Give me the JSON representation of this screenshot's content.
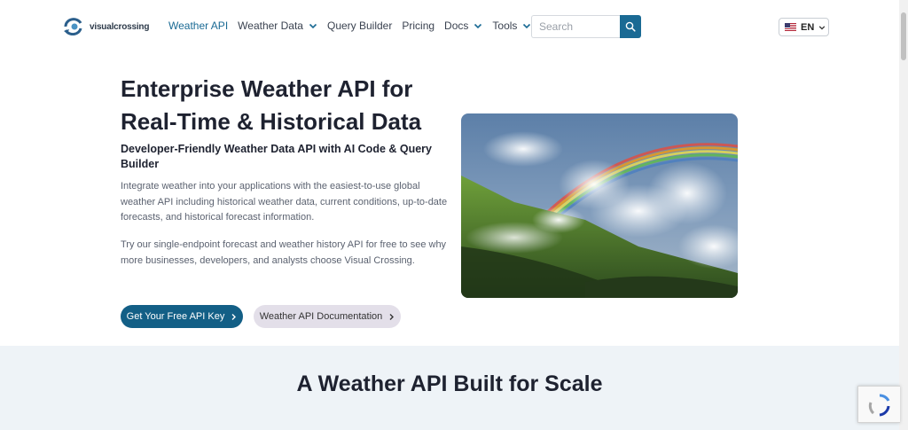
{
  "header": {
    "logo_text": "visualcrossing",
    "nav": [
      {
        "label": "Weather API",
        "dropdown": false,
        "active": true
      },
      {
        "label": "Weather Data",
        "dropdown": true,
        "active": false
      },
      {
        "label": "Query Builder",
        "dropdown": false,
        "active": false
      },
      {
        "label": "Pricing",
        "dropdown": false,
        "active": false
      },
      {
        "label": "Docs",
        "dropdown": true,
        "active": false
      },
      {
        "label": "Tools",
        "dropdown": true,
        "active": false
      }
    ],
    "search_placeholder": "Search",
    "language": "EN"
  },
  "hero": {
    "title": "Enterprise Weather API for Real-Time & Historical Data",
    "subtitle": "Developer-Friendly Weather Data API with AI Code & Query Builder",
    "paragraph_1": "Integrate weather into your applications with the easiest-to-use global weather API including historical weather data, current conditions, up-to-date forecasts, and historical forecast information.",
    "paragraph_2": "Try our single-endpoint forecast and weather history API for free to see why more businesses, developers, and analysts choose Visual Crossing.",
    "primary_button": "Get Your Free API Key",
    "secondary_button": "Weather API Documentation"
  },
  "scale_section": {
    "title": "A Weather API Built for Scale"
  },
  "colors": {
    "brand": "#1a6a94",
    "primary_button": "#135f86",
    "secondary_button": "#e3dfe9",
    "section_bg": "#eef3f7"
  },
  "icons": {
    "search": "search-icon",
    "dropdown": "chevron-down-icon",
    "flag": "us-flag-icon",
    "arrow": "chevron-right-icon"
  }
}
